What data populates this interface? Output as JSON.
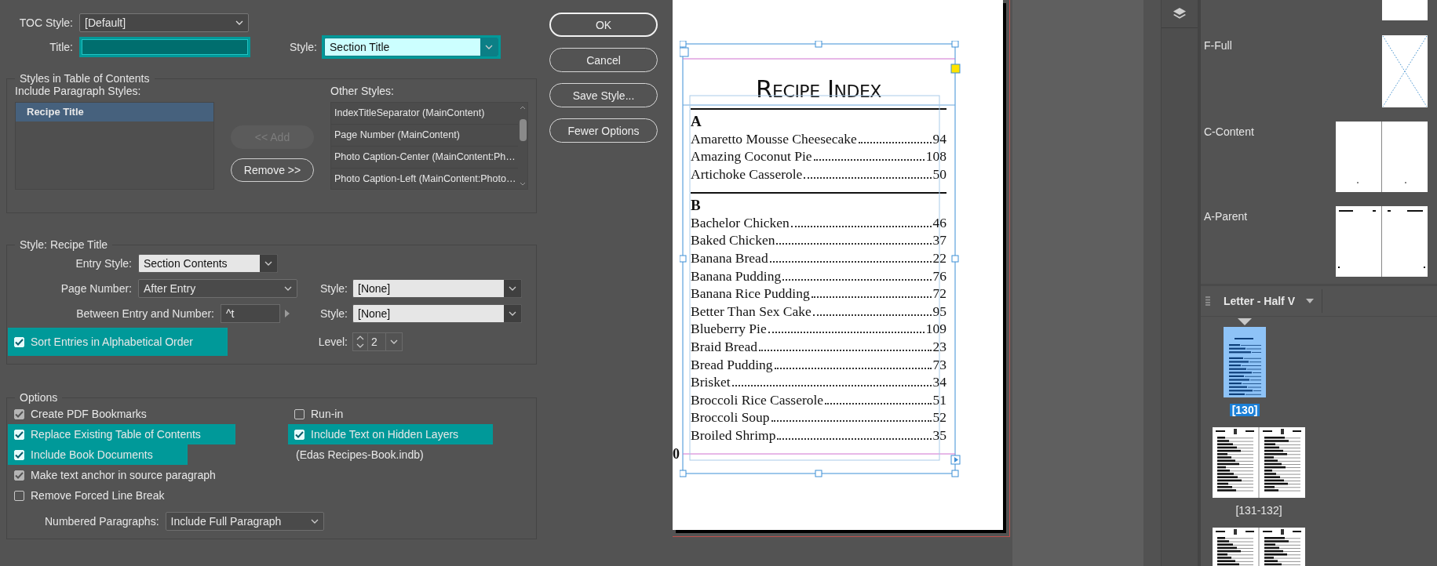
{
  "dialog": {
    "toc_style": {
      "label": "TOC Style:",
      "value": "[Default]"
    },
    "title": {
      "label": "Title:",
      "highlighted": true
    },
    "title_style": {
      "label": "Style:",
      "value": "Section Title",
      "highlighted": true
    },
    "styles_group": {
      "legend": "Styles in Table of Contents",
      "include_label": "Include Paragraph Styles:",
      "included": [
        {
          "label": "Recipe Title",
          "selected": true
        }
      ],
      "buttons": [
        {
          "label": "<< Add",
          "disabled": true
        },
        {
          "label": "Remove >>",
          "disabled": false
        }
      ],
      "other_label": "Other Styles:",
      "other_styles": [
        "IndexTitleSeparator (MainContent)",
        "Page Number (MainContent)",
        "Photo Caption-Center (MainContent:Ph…",
        "Photo Caption-Left (MainContent:Photo…"
      ]
    },
    "style_group": {
      "legend": "Style: Recipe Title",
      "entry_style": {
        "label": "Entry Style:",
        "value": "Section Contents"
      },
      "page_number": {
        "label": "Page Number:",
        "value": "After Entry"
      },
      "page_number_style": {
        "label": "Style:",
        "value": "[None]"
      },
      "between": {
        "label": "Between Entry and Number:",
        "value": "^t"
      },
      "between_style": {
        "label": "Style:",
        "value": "[None]"
      },
      "sort": {
        "label": "Sort Entries in Alphabetical Order",
        "checked": true,
        "highlighted": true
      },
      "level": {
        "label": "Level:",
        "value": "2"
      }
    },
    "options_group": {
      "legend": "Options",
      "left": [
        {
          "label": "Create PDF Bookmarks",
          "checked": true,
          "dimmed": true,
          "highlighted": false
        },
        {
          "label": "Replace Existing Table of Contents",
          "checked": true,
          "dimmed": false,
          "highlighted": true
        },
        {
          "label": "Include Book Documents",
          "checked": true,
          "dimmed": false,
          "highlighted": true
        },
        {
          "label": "Make text anchor in source paragraph",
          "checked": true,
          "dimmed": true,
          "highlighted": false
        },
        {
          "label": "Remove Forced Line Break",
          "checked": false,
          "dimmed": false,
          "highlighted": false
        }
      ],
      "right": [
        {
          "label": "Run-in",
          "checked": false,
          "dimmed": false,
          "highlighted": false
        },
        {
          "label": "Include Text on Hidden Layers",
          "checked": true,
          "dimmed": false,
          "highlighted": true
        }
      ],
      "book_file": "(Edas Recipes-Book.indb)",
      "numbered": {
        "label": "Numbered Paragraphs:",
        "value": "Include Full Paragraph"
      }
    },
    "buttons": [
      {
        "label": "OK",
        "default": true
      },
      {
        "label": "Cancel",
        "default": false
      },
      {
        "label": "Save Style...",
        "default": false
      },
      {
        "label": "Fewer Options",
        "default": false
      }
    ]
  },
  "document": {
    "title": "Recipe Index",
    "page_number_fragment": "0",
    "sections": [
      {
        "letter": "A",
        "entries": [
          {
            "name": "Amaretto Mousse Cheesecake",
            "page": "94"
          },
          {
            "name": "Amazing Coconut Pie",
            "page": "108"
          },
          {
            "name": "Artichoke Casserole",
            "page": "50"
          }
        ]
      },
      {
        "letter": "B",
        "entries": [
          {
            "name": "Bachelor Chicken",
            "page": "46"
          },
          {
            "name": "Baked Chicken",
            "page": "37"
          },
          {
            "name": "Banana Bread",
            "page": "22"
          },
          {
            "name": "Banana Pudding",
            "page": "76"
          },
          {
            "name": "Banana Rice Pudding",
            "page": "72"
          },
          {
            "name": "Better Than Sex Cake",
            "page": "95"
          },
          {
            "name": "Blueberry Pie",
            "page": "109"
          },
          {
            "name": "Braid Bread",
            "page": "23"
          },
          {
            "name": "Bread Pudding",
            "page": "73"
          },
          {
            "name": "Brisket",
            "page": "34"
          },
          {
            "name": "Broccoli Rice Casserole",
            "page": "51"
          },
          {
            "name": "Broccoli Soup",
            "page": "52"
          },
          {
            "name": "Broiled Shrimp",
            "page": "35"
          }
        ]
      }
    ]
  },
  "pages_panel": {
    "parents": [
      {
        "kind": "single-blank"
      },
      {
        "name": "F-Full",
        "kind": "single-frame"
      },
      {
        "name": "C-Content",
        "kind": "spread-blank"
      },
      {
        "name": "A-Parent",
        "kind": "spread-header"
      }
    ],
    "page_size": "Letter - Half V",
    "pages": [
      {
        "label": "[130]",
        "selected": true,
        "kind": "single"
      },
      {
        "label": "[131-132]",
        "selected": false,
        "kind": "spread"
      },
      {
        "selected": false,
        "kind": "spread"
      }
    ]
  }
}
